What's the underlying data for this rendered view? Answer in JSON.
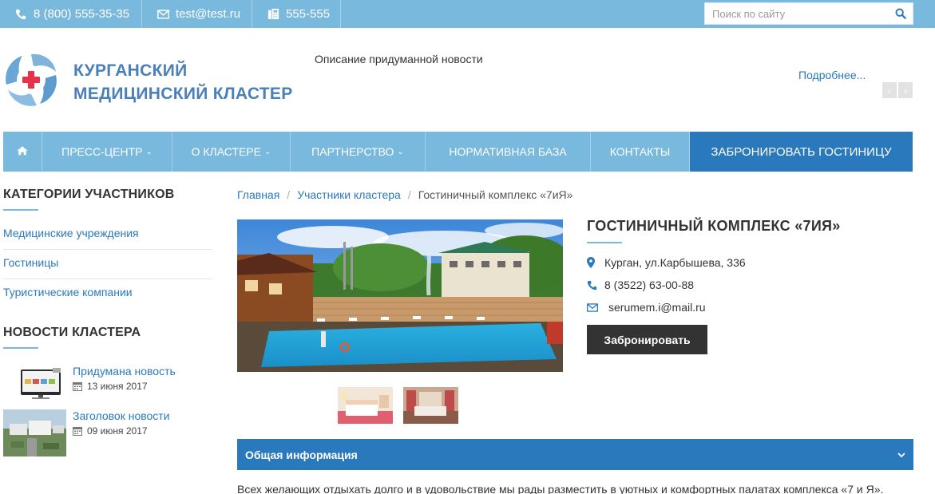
{
  "topbar": {
    "phone": "8 (800) 555-35-35",
    "email": "test@test.ru",
    "fax": "555-555",
    "search_placeholder": "Поиск по сайту"
  },
  "header": {
    "brand_line1": "КУРГАНСКИЙ",
    "brand_line2": "МЕДИЦИНСКИЙ КЛАСТЕР",
    "news_description": "Описание придуманной новости",
    "more_link": "Подробнее...",
    "prev_arrow": "‹",
    "next_arrow": "›"
  },
  "nav": {
    "home_icon": "home-icon",
    "items": [
      {
        "label": "ПРЕСС-ЦЕНТР",
        "dropdown": true
      },
      {
        "label": "О КЛАСТЕРЕ",
        "dropdown": true
      },
      {
        "label": "ПАРТНЕРСТВО",
        "dropdown": true
      },
      {
        "label": "НОРМАТИВНАЯ БАЗА",
        "dropdown": false
      },
      {
        "label": "КОНТАКТЫ",
        "dropdown": false
      },
      {
        "label": "ЗАБРОНИРОВАТЬ ГОСТИНИЦУ",
        "dropdown": false
      }
    ]
  },
  "sidebar": {
    "categories_title": "КАТЕГОРИИ УЧАСТНИКОВ",
    "categories": [
      "Медицинские учреждения",
      "Гостиницы",
      "Туристические компании"
    ],
    "news_title": "НОВОСТИ КЛАСТЕРА",
    "news": [
      {
        "title": "Придумана новость",
        "date": "13 июня 2017"
      },
      {
        "title": "Заголовок новости",
        "date": "09 июня 2017"
      }
    ]
  },
  "breadcrumb": {
    "items": [
      "Главная",
      "Участники кластера",
      "Гостиничный комплекс «7иЯ»"
    ],
    "separator": "/"
  },
  "hotel": {
    "title": "ГОСТИНИЧНЫЙ КОМПЛЕКС «7ИЯ»",
    "address": "Курган, ул.Карбышева, 336",
    "phone": "8 (3522) 63-00-88",
    "email": "serumem.i@mail.ru",
    "book_button": "Забронировать"
  },
  "accordion": {
    "title": "Общая информация",
    "body": "Всех желающих отдыхать долго и в удовольствие мы рады разместить в уютных и комфортных палатах комплекса «7 и Я»."
  },
  "colors": {
    "topbar": "#7ab9de",
    "accent": "#2a79bd",
    "brand": "#4a7fb8",
    "logo_red": "#e8314a",
    "dark_button": "#333333"
  }
}
